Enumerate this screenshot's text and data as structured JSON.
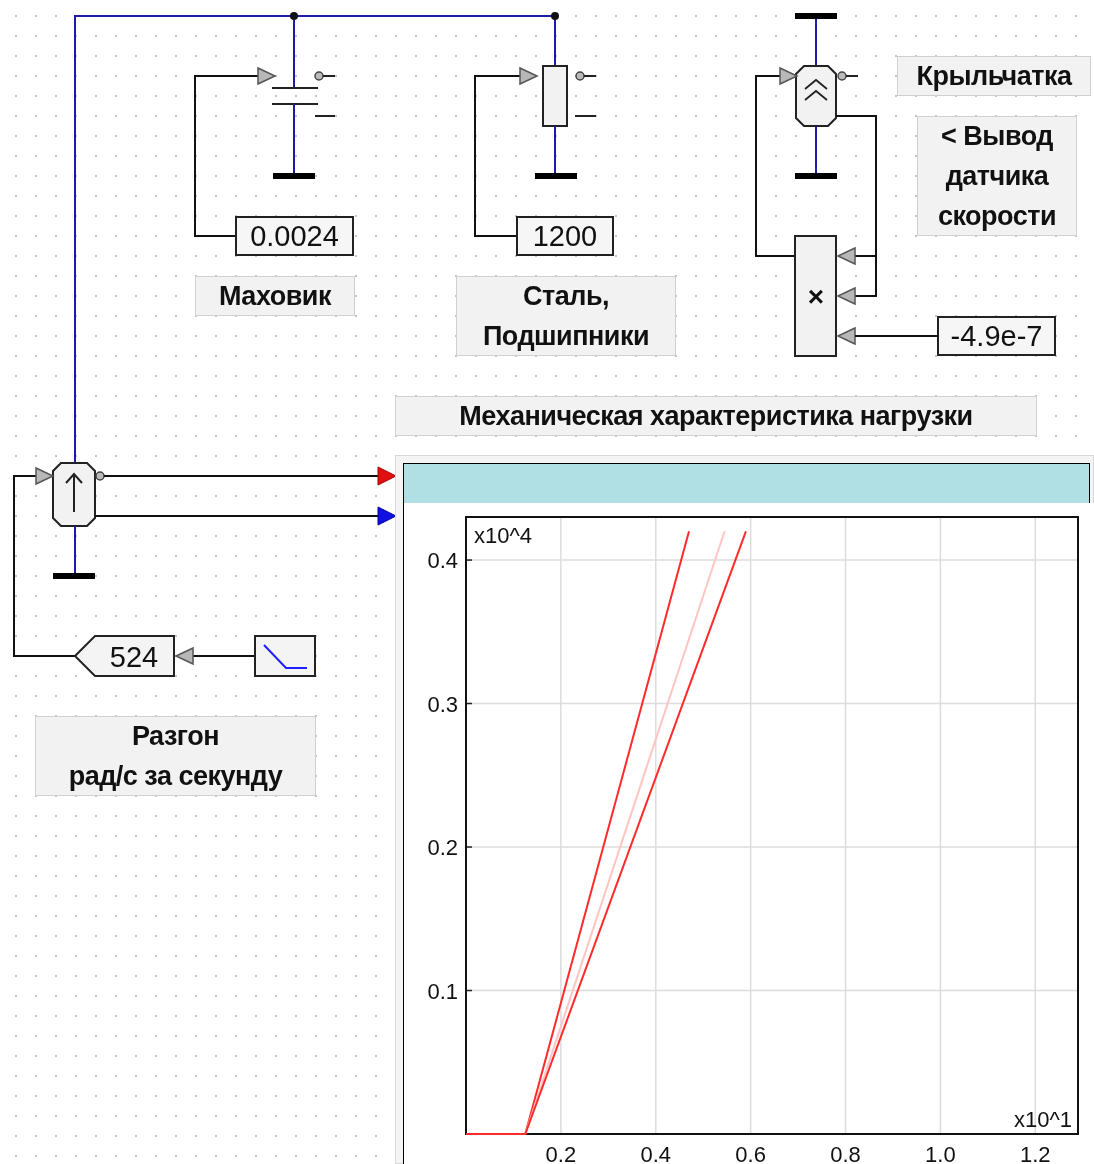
{
  "labels": [
    {
      "text": "Крыльчатка"
    },
    {
      "text": "< Вывод\nдатчика\nскорости"
    },
    {
      "text": "Маховик"
    },
    {
      "text": "Сталь,\nПодшипники"
    },
    {
      "text": "Механическая характеристика нагрузки"
    },
    {
      "text": "Разгон\nрад/с за секунду"
    }
  ],
  "constants": [
    {
      "value": "0.0024"
    },
    {
      "value": "1200"
    },
    {
      "value": "-4.9e-7"
    }
  ],
  "multiplier": {
    "symbol": "×"
  },
  "gain_block": {
    "value": "524"
  },
  "plot": {
    "y_scale_label": "x10^4",
    "x_scale_label": "x10^1",
    "chart_data": {
      "type": "line",
      "grid": true,
      "xlim": [
        0,
        1.29
      ],
      "ylim": [
        0,
        0.43
      ],
      "xticks": [
        0.2,
        0.4,
        0.6,
        0.8,
        {
          "value": 1.0,
          "label": "1.0"
        },
        1.2
      ],
      "yticks": [
        0.1,
        0.2,
        0.3,
        0.4
      ],
      "series": [
        {
          "color": "#ff2a2a",
          "x": [
            0,
            0.125,
            0.47
          ],
          "values": [
            0,
            0,
            0.42
          ]
        },
        {
          "color": "#ffc4c4",
          "x": [
            0.125,
            0.545
          ],
          "values": [
            0,
            0.42
          ]
        },
        {
          "color": "#ff2a2a",
          "x": [
            0.125,
            0.59
          ],
          "values": [
            0,
            0.42
          ]
        }
      ]
    }
  }
}
